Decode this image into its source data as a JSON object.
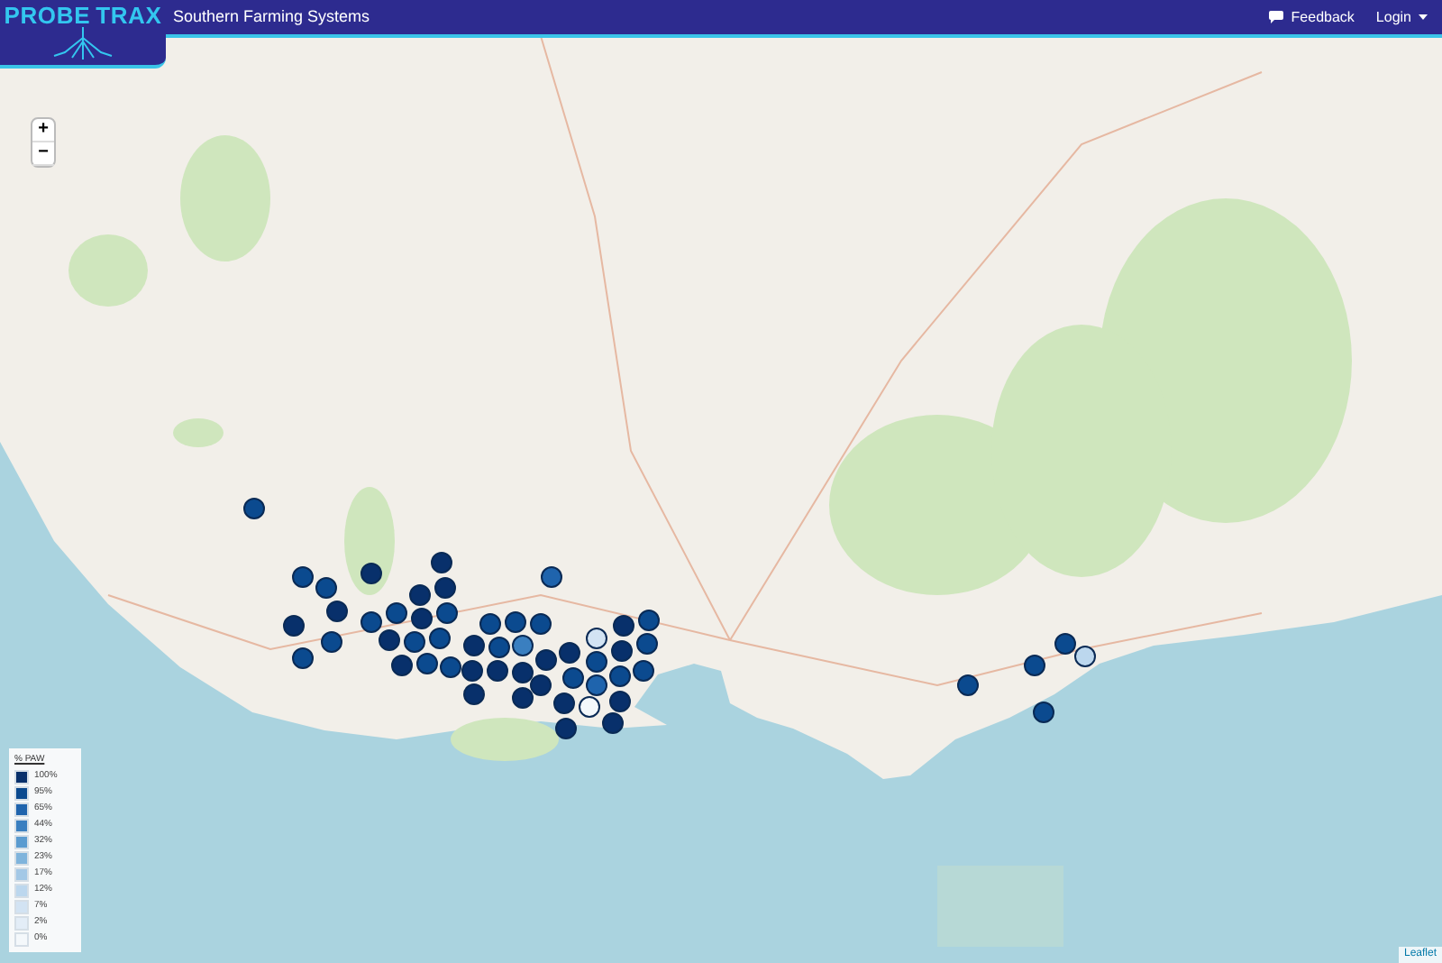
{
  "header": {
    "logo": [
      "PROBE",
      "TRAX"
    ],
    "title": "Southern Farming Systems",
    "nav": [
      {
        "label": "Feedback",
        "kind": "feedback"
      },
      {
        "label": "Login",
        "kind": "dropdown"
      }
    ]
  },
  "zoom_controls": [
    "+",
    "−"
  ],
  "legend": {
    "title": "% PAW",
    "items": [
      {
        "label": "100%",
        "color": "#08306b"
      },
      {
        "label": "95%",
        "color": "#0b4a8f"
      },
      {
        "label": "65%",
        "color": "#1f64ad"
      },
      {
        "label": "44%",
        "color": "#3a7fc0"
      },
      {
        "label": "32%",
        "color": "#5a9bd0"
      },
      {
        "label": "23%",
        "color": "#7fb4dc"
      },
      {
        "label": "17%",
        "color": "#a3c8e6"
      },
      {
        "label": "12%",
        "color": "#bcd7ee"
      },
      {
        "label": "7%",
        "color": "#d2e3f3"
      },
      {
        "label": "2%",
        "color": "#e3edf7"
      },
      {
        "label": "0%",
        "color": "#f4f8fb"
      }
    ]
  },
  "markers": [
    {
      "color": "#0b4a8f"
    },
    {
      "color": "#0b4a8f"
    },
    {
      "color": "#0b4a8f"
    },
    {
      "color": "#08306b"
    },
    {
      "color": "#08306b"
    },
    {
      "color": "#08306b"
    },
    {
      "color": "#0b4a8f"
    },
    {
      "color": "#0b4a8f"
    },
    {
      "color": "#08306b"
    },
    {
      "color": "#08306b"
    },
    {
      "color": "#08306b"
    },
    {
      "color": "#0b4a8f"
    },
    {
      "color": "#08306b"
    },
    {
      "color": "#0b4a8f"
    },
    {
      "color": "#08306b"
    },
    {
      "color": "#0b4a8f"
    },
    {
      "color": "#0b4a8f"
    },
    {
      "color": "#0b4a8f"
    },
    {
      "color": "#08306b"
    },
    {
      "color": "#0b4a8f"
    },
    {
      "color": "#0b4a8f"
    },
    {
      "color": "#1f64ad"
    },
    {
      "color": "#0b4a8f"
    },
    {
      "color": "#0b4a8f"
    },
    {
      "color": "#3a7fc0"
    },
    {
      "color": "#0b4a8f"
    },
    {
      "color": "#0b4a8f"
    },
    {
      "color": "#08306b"
    },
    {
      "color": "#08306b"
    },
    {
      "color": "#08306b"
    },
    {
      "color": "#08306b"
    },
    {
      "color": "#08306b"
    },
    {
      "color": "#08306b"
    },
    {
      "color": "#08306b"
    },
    {
      "color": "#08306b"
    },
    {
      "color": "#08306b"
    },
    {
      "color": "#d2e3f3"
    },
    {
      "color": "#08306b"
    },
    {
      "color": "#08306b"
    },
    {
      "color": "#0b4a8f"
    },
    {
      "color": "#0b4a8f"
    },
    {
      "color": "#0b4a8f"
    },
    {
      "color": "#08306b"
    },
    {
      "color": "#1f64ad"
    },
    {
      "color": "#0b4a8f"
    },
    {
      "color": "#0b4a8f"
    },
    {
      "color": "#08306b"
    },
    {
      "color": "#08306b"
    },
    {
      "color": "#f4f8fb"
    },
    {
      "color": "#08306b"
    },
    {
      "color": "#0b4a8f"
    },
    {
      "color": "#0b4a8f"
    },
    {
      "color": "#0b4a8f"
    },
    {
      "color": "#0b4a8f"
    },
    {
      "color": "#bcd7ee"
    },
    {
      "color": "#0b4a8f"
    }
  ],
  "attribution": "Leaflet"
}
